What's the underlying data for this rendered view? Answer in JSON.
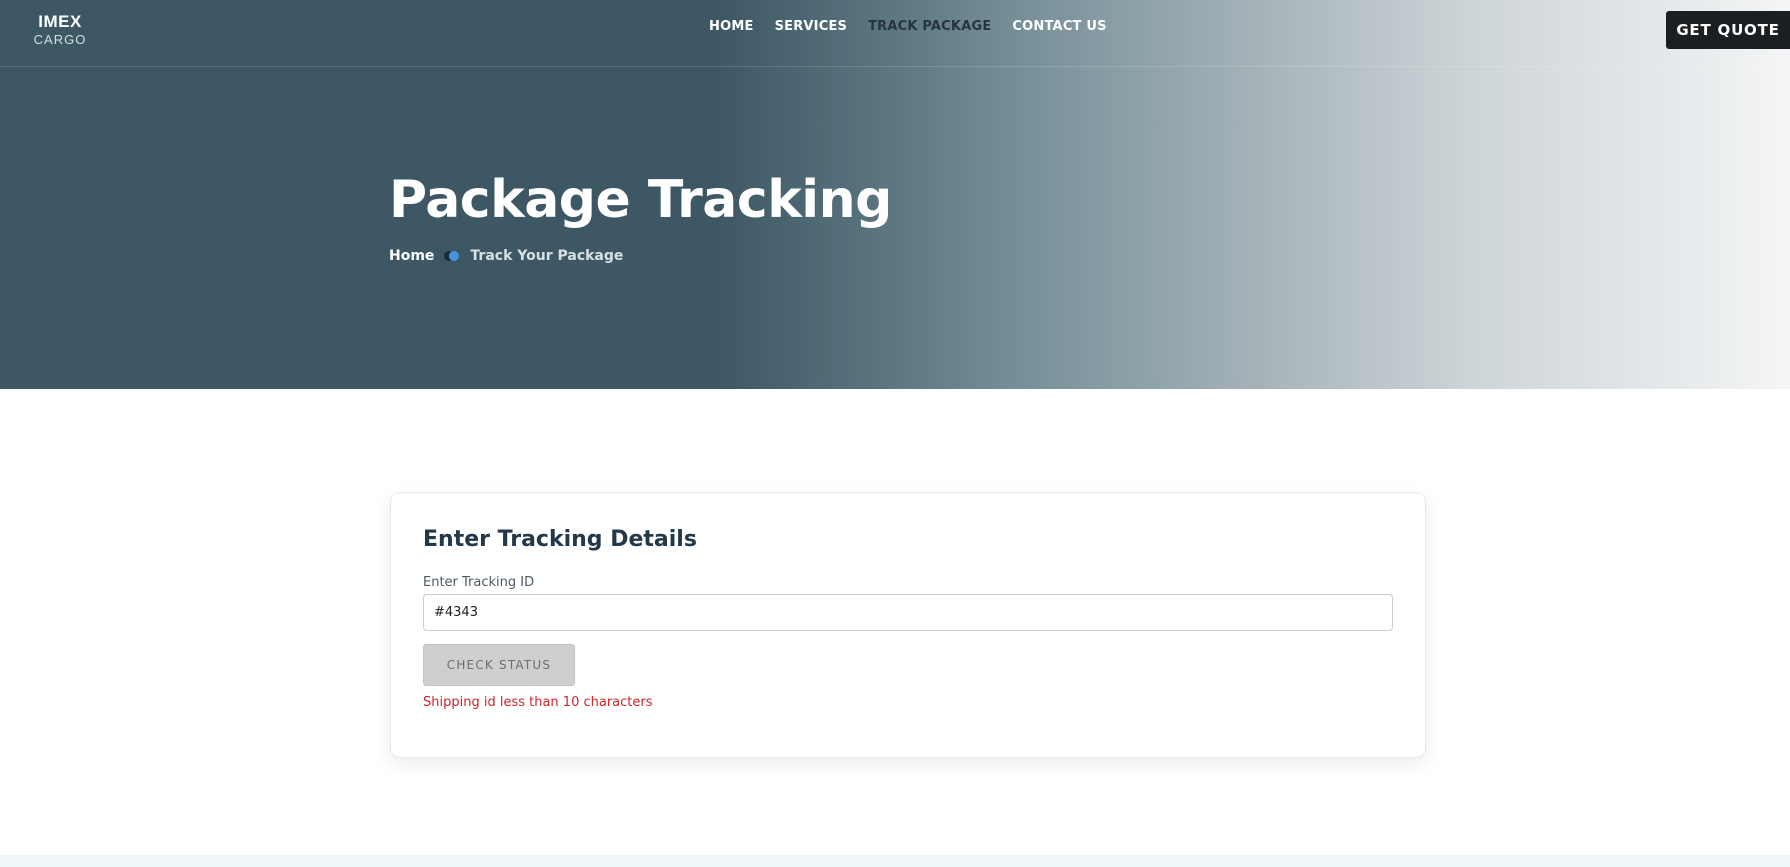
{
  "brand": {
    "name": "IMEX",
    "subtitle": "CARGO"
  },
  "nav": {
    "items": [
      {
        "label": "HOME"
      },
      {
        "label": "SERVICES"
      },
      {
        "label": "TRACK PACKAGE"
      },
      {
        "label": "CONTACT US"
      }
    ],
    "active": "TRACK PACKAGE",
    "cta_label": "GET QUOTE"
  },
  "hero": {
    "title": "Package Tracking",
    "breadcrumb": {
      "home": "Home",
      "current": "Track Your Package"
    }
  },
  "tracking_form": {
    "title": "Enter Tracking Details",
    "id_label": "Enter Tracking ID",
    "id_value": "#4343",
    "submit_label": "CHECK STATUS",
    "error_message": "Shipping id less than 10 characters"
  },
  "colors": {
    "hero_dark": "#3d5864",
    "cta_background": "#1c1f21",
    "card_title": "#23384a",
    "error": "#d2232a",
    "breadcrumb_accent": "#4b8fe0",
    "disabled_button": "#cfcfcf"
  }
}
